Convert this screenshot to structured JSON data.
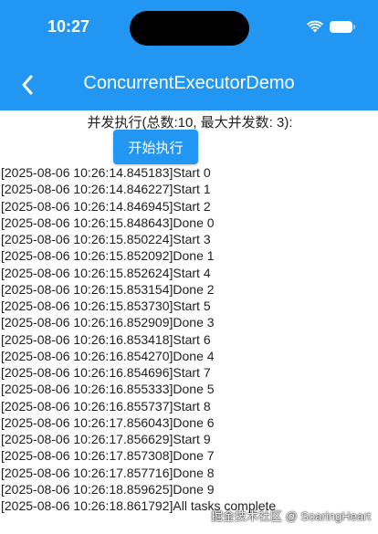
{
  "status_bar": {
    "time": "10:27",
    "icons": [
      "wifi-icon",
      "battery-icon"
    ]
  },
  "app_bar": {
    "title": "ConcurrentExecutorDemo",
    "back_icon": "chevron-left-icon",
    "color": "#2196f3"
  },
  "main": {
    "subtitle": "并发执行(总数:10, 最大并发数: 3):",
    "start_button_label": "开始执行",
    "log": [
      "[2025-08-06 10:26:14.845183]Start 0",
      "[2025-08-06 10:26:14.846227]Start 1",
      "[2025-08-06 10:26:14.846945]Start 2",
      "[2025-08-06 10:26:15.848643]Done 0",
      "[2025-08-06 10:26:15.850224]Start 3",
      "[2025-08-06 10:26:15.852092]Done 1",
      "[2025-08-06 10:26:15.852624]Start 4",
      "[2025-08-06 10:26:15.853154]Done 2",
      "[2025-08-06 10:26:15.853730]Start 5",
      "[2025-08-06 10:26:16.852909]Done 3",
      "[2025-08-06 10:26:16.853418]Start 6",
      "[2025-08-06 10:26:16.854270]Done 4",
      "[2025-08-06 10:26:16.854696]Start 7",
      "[2025-08-06 10:26:16.855333]Done 5",
      "[2025-08-06 10:26:16.855737]Start 8",
      "[2025-08-06 10:26:17.856043]Done 6",
      "[2025-08-06 10:26:17.856629]Start 9",
      "[2025-08-06 10:26:17.857308]Done 7",
      "[2025-08-06 10:26:17.857716]Done 8",
      "[2025-08-06 10:26:18.859625]Done 9",
      "[2025-08-06 10:26:18.861792]All tasks complete"
    ]
  },
  "watermark": "掘金技术社区 @ SoaringHeart"
}
